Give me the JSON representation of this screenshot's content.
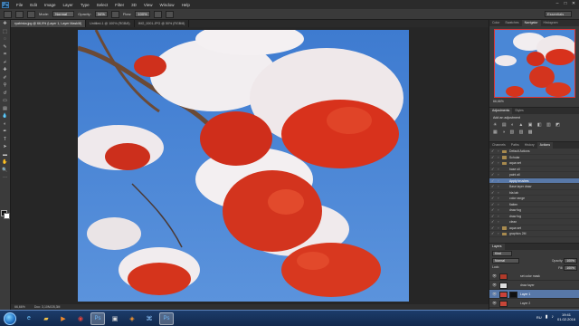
{
  "app": {
    "logo": "Ps"
  },
  "menu": {
    "items": [
      "File",
      "Edit",
      "Image",
      "Layer",
      "Type",
      "Select",
      "Filter",
      "3D",
      "View",
      "Window",
      "Help"
    ]
  },
  "options": {
    "mode_label": "Mode:",
    "mode_value": "Normal",
    "opacity_label": "Opacity:",
    "opacity_value": "34%",
    "flow_label": "Flow:",
    "flow_value": "100%",
    "workspace": "Essentials"
  },
  "tabs": [
    "ryabinka.jpg @ 66,9% (Layer 1, Layer Mask/8)",
    "Untitled-1 @ 100% (RGB/8)",
    "IMG_0001.JPG @ 50% (RGB/8)"
  ],
  "status": {
    "zoom": "66,66%",
    "doc": "Doc: 3,10M/28,3M"
  },
  "panels": {
    "nav_tabs": [
      "Color",
      "Swatches",
      "Navigator",
      "Histogram"
    ],
    "nav_zoom": "66,66%",
    "adj_tabs": [
      "Adjustments",
      "Styles"
    ],
    "adj_title": "Add an adjustment",
    "actions_tabs": [
      "Channels",
      "Paths",
      "History",
      "Actions"
    ],
    "actions": [
      {
        "label": "Default Actions",
        "folder": true,
        "selected": false
      },
      {
        "label": "Scholar",
        "folder": true,
        "selected": false
      },
      {
        "label": "aqua set",
        "folder": true,
        "selected": false
      },
      {
        "label": "base oil",
        "folder": false,
        "selected": false
      },
      {
        "label": "paint all",
        "folder": false,
        "selected": false
      },
      {
        "label": "Apply brushes",
        "folder": false,
        "selected": true
      },
      {
        "label": "Base layer draw",
        "folder": false,
        "selected": false
      },
      {
        "label": "bla lab",
        "folder": false,
        "selected": false
      },
      {
        "label": "color range",
        "folder": false,
        "selected": false
      },
      {
        "label": "flatten",
        "folder": false,
        "selected": false
      },
      {
        "label": "draw fog",
        "folder": false,
        "selected": false
      },
      {
        "label": "draw fog",
        "folder": false,
        "selected": false
      },
      {
        "label": "clean",
        "folder": false,
        "selected": false
      },
      {
        "label": "aqua set",
        "folder": true,
        "selected": false
      },
      {
        "label": "graphics 2M",
        "folder": true,
        "selected": false
      }
    ],
    "layers_tabs": [
      "Layers"
    ],
    "layers_kind": "Kind",
    "blend_mode": "Normal",
    "opacity_label": "Opacity:",
    "opacity_value": "100%",
    "lock_label": "Lock:",
    "fill_label": "Fill:",
    "fill_value": "100%",
    "layers": [
      {
        "name": "set color mask",
        "selected": false,
        "thumb": "#b03a2a"
      },
      {
        "name": "draw layer",
        "selected": false,
        "thumb": "#dddddd"
      },
      {
        "name": "Layer 1",
        "selected": true,
        "thumb": "#c9423a",
        "mask": true
      },
      {
        "name": "Layer 2",
        "selected": false,
        "thumb": "#c64638"
      }
    ]
  },
  "taskbar": {
    "apps": [
      "ie-icon",
      "folder-icon",
      "media-icon",
      "chrome-icon",
      "photoshop-icon",
      "image-viewer-icon",
      "wmp-icon",
      "network-icon",
      "ps-doc-icon"
    ],
    "lang": "RU",
    "time": "19:41",
    "date": "01.02.2016"
  },
  "colors": {
    "sky": "#3f7fd0",
    "berry": "#d8321c",
    "snow": "#f2eef0",
    "accent": "#5878a8"
  }
}
